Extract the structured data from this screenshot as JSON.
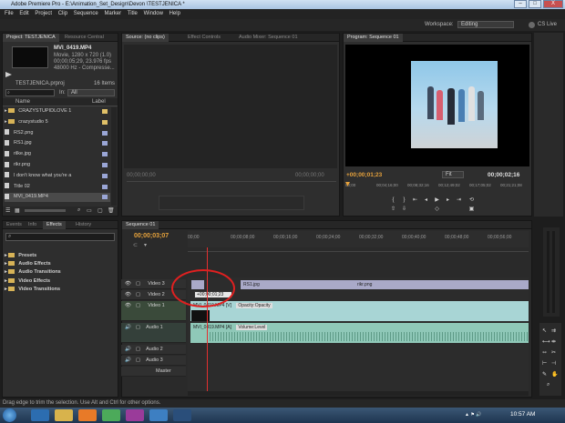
{
  "window": {
    "title": "Adobe Premiere Pro - E:\\Animation_Set_Design\\Devon \\TESTJENICA *",
    "min": "–",
    "max": "□",
    "close": "X"
  },
  "menu": [
    "File",
    "Edit",
    "Project",
    "Clip",
    "Sequence",
    "Marker",
    "Title",
    "Window",
    "Help"
  ],
  "workspace": {
    "label": "Workspace:",
    "value": "Editing",
    "cslive": "CS Live"
  },
  "project": {
    "tabs": [
      "Project: TESTJENICA",
      "Resource Central"
    ],
    "clip_name": "MVI_0419.MP4",
    "clip_info": [
      "Movie, 1280 x 720 (1.0)",
      "00;00;05;29, 23.976 fps",
      "48000 Hz - Compresse..."
    ],
    "project_file": "TESTJENICA.prproj",
    "item_count": "16 Items",
    "in_label": "In:",
    "in_value": "All",
    "col_name": "Name",
    "col_label": "Label",
    "items": [
      {
        "name": "CRAZYSTUPIDLOVE 1",
        "type": "folder",
        "color": "#e0c068"
      },
      {
        "name": "crazystudio 5",
        "type": "folder",
        "color": "#e0c068"
      },
      {
        "name": "RS2.png",
        "type": "file",
        "color": "#9aa6d6"
      },
      {
        "name": "RS1.jpg",
        "type": "file",
        "color": "#9aa6d6"
      },
      {
        "name": "rilke.jpg",
        "type": "file",
        "color": "#9aa6d6"
      },
      {
        "name": "rikr.png",
        "type": "file",
        "color": "#9aa6d6"
      },
      {
        "name": "I don't know what you're a",
        "type": "file",
        "color": "#9aa6d6"
      },
      {
        "name": "Title 02",
        "type": "file",
        "color": "#9aa6d6"
      },
      {
        "name": "MVI_0419.MP4",
        "type": "file",
        "color": "#9aa6d6"
      }
    ]
  },
  "source": {
    "tabs": [
      "Source: (no clips)",
      "Effect Controls",
      "Audio Mixer: Sequence 01"
    ],
    "tc_left": "00;00;00;00",
    "tc_right": "00;00;00;00"
  },
  "program": {
    "tab": "Program: Sequence 01",
    "tc_current": "+00;00;01;23",
    "fit": "Fit",
    "tc_duration": "00;00;02;16",
    "ruler": [
      "00;00",
      "00;04;16;00",
      "00;08;32;16",
      "00;12;49;02",
      "00;17;05;02",
      "00;21;21;08"
    ]
  },
  "effects": {
    "tabs": [
      "Events",
      "Info",
      "Effects",
      "History"
    ],
    "folders": [
      "Presets",
      "Audio Effects",
      "Audio Transitions",
      "Video Effects",
      "Video Transitions"
    ]
  },
  "timeline": {
    "tab": "Sequence 01",
    "timecode": "00;00;03;07",
    "ruler": [
      "00;00",
      "00;00;08;00",
      "00;00;16;00",
      "00;00;24;00",
      "00;00;32;00",
      "00;00;40;00",
      "00;00;48;00",
      "00;00;56;00"
    ],
    "tracks": [
      {
        "name": "Video 3"
      },
      {
        "name": "Video 2"
      },
      {
        "name": "Video 1"
      },
      {
        "name": "Audio 1"
      },
      {
        "name": "Audio 2"
      },
      {
        "name": "Audio 3"
      },
      {
        "name": "Master"
      }
    ],
    "clips": {
      "v3a": "RS1.jpg",
      "v3b": "rikr.png",
      "tooltip": "+00;00;01;23",
      "v1": "MVI_0419.MP4 [V]",
      "v1_effect": "Opacity:Opacity",
      "a1": "MVI_0419.MP4 [A]",
      "a1_effect": "Volume:Level"
    }
  },
  "status": "Drag edge to trim the selection. Use Alt and Ctrl for other options.",
  "clock": "10:57 AM",
  "accent": "#e6a23c",
  "playhead": "#e23030",
  "annotation": "#e02020"
}
